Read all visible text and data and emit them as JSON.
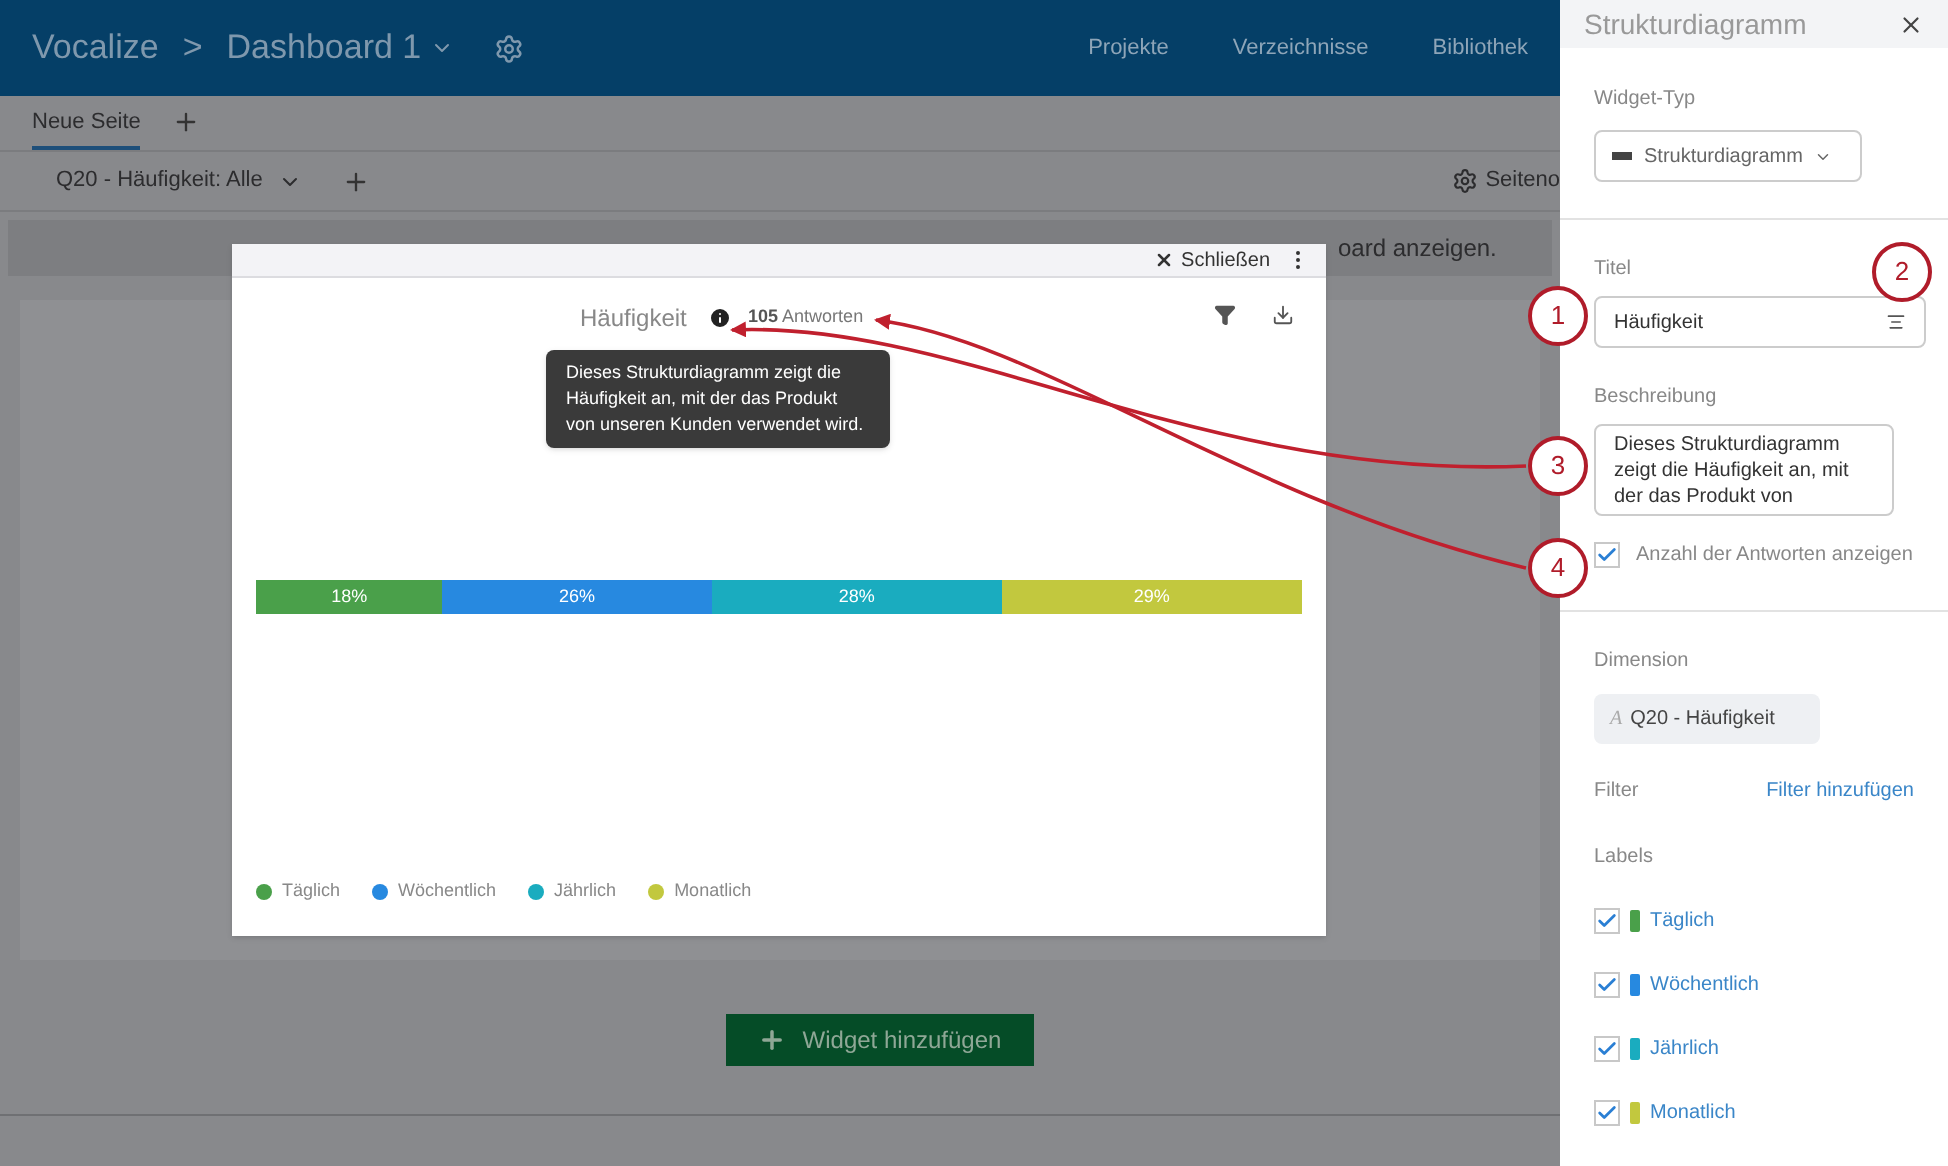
{
  "header": {
    "brand": "Vocalize",
    "breadcrumb_separator": ">",
    "dashboard": "Dashboard 1",
    "nav": [
      "Projekte",
      "Verzeichnisse",
      "Bibliothek"
    ]
  },
  "page_tabs": [
    {
      "label": "Neue Seite",
      "selected": true
    }
  ],
  "filter_bar": {
    "filter": "Q20 - Häufigkeit: Alle",
    "settings": "Seiteno"
  },
  "banner": {
    "text": "oard anzeigen."
  },
  "add_widget_button": "Widget hinzufügen",
  "widget": {
    "close": "Schließen",
    "title": "Häufigkeit",
    "responses_count": "105",
    "responses_label": "Antworten",
    "tooltip": "Dieses Strukturdiagramm zeigt die Häufigkeit an, mit der das Produkt von unseren Kunden verwendet wird.",
    "chart_data": {
      "type": "bar",
      "orientation": "horizontal",
      "stacked": true,
      "series": [
        {
          "name": "Täglich",
          "color": "#4aa04a",
          "values": [
            18
          ],
          "value_labels": [
            "18%"
          ]
        },
        {
          "name": "Wöchentlich",
          "color": "#2789e0",
          "values": [
            26
          ],
          "value_labels": [
            "26%"
          ]
        },
        {
          "name": "Jährlich",
          "color": "#1aacbf",
          "values": [
            28
          ],
          "value_labels": [
            "28%"
          ]
        },
        {
          "name": "Monatlich",
          "color": "#c2c83e",
          "values": [
            29
          ],
          "value_labels": [
            "29%"
          ]
        }
      ]
    }
  },
  "panel": {
    "title": "Strukturdiagramm",
    "widget_type_label": "Widget-Typ",
    "widget_type": "Strukturdiagramm",
    "title_label": "Titel",
    "title_value": "Häufigkeit",
    "description_label": "Beschreibung",
    "description_value": "Dieses Strukturdiagramm zeigt die Häufigkeit an, mit der das Produkt von",
    "show_responses": {
      "label": "Anzahl der Antworten anzeigen",
      "checked": true
    },
    "dimension_label": "Dimension",
    "dimension_icon": "A",
    "dimension": "Q20 - Häufigkeit",
    "filter_label": "Filter",
    "add_filter": "Filter hinzufügen",
    "labels_label": "Labels",
    "labels": [
      {
        "name": "Täglich",
        "checked": true,
        "color": "#4aa04a"
      },
      {
        "name": "Wöchentlich",
        "checked": true,
        "color": "#2789e0"
      },
      {
        "name": "Jährlich",
        "checked": true,
        "color": "#1aacbf"
      },
      {
        "name": "Monatlich",
        "checked": true,
        "color": "#c2c83e"
      }
    ]
  },
  "callouts": [
    "1",
    "2",
    "3",
    "4"
  ]
}
